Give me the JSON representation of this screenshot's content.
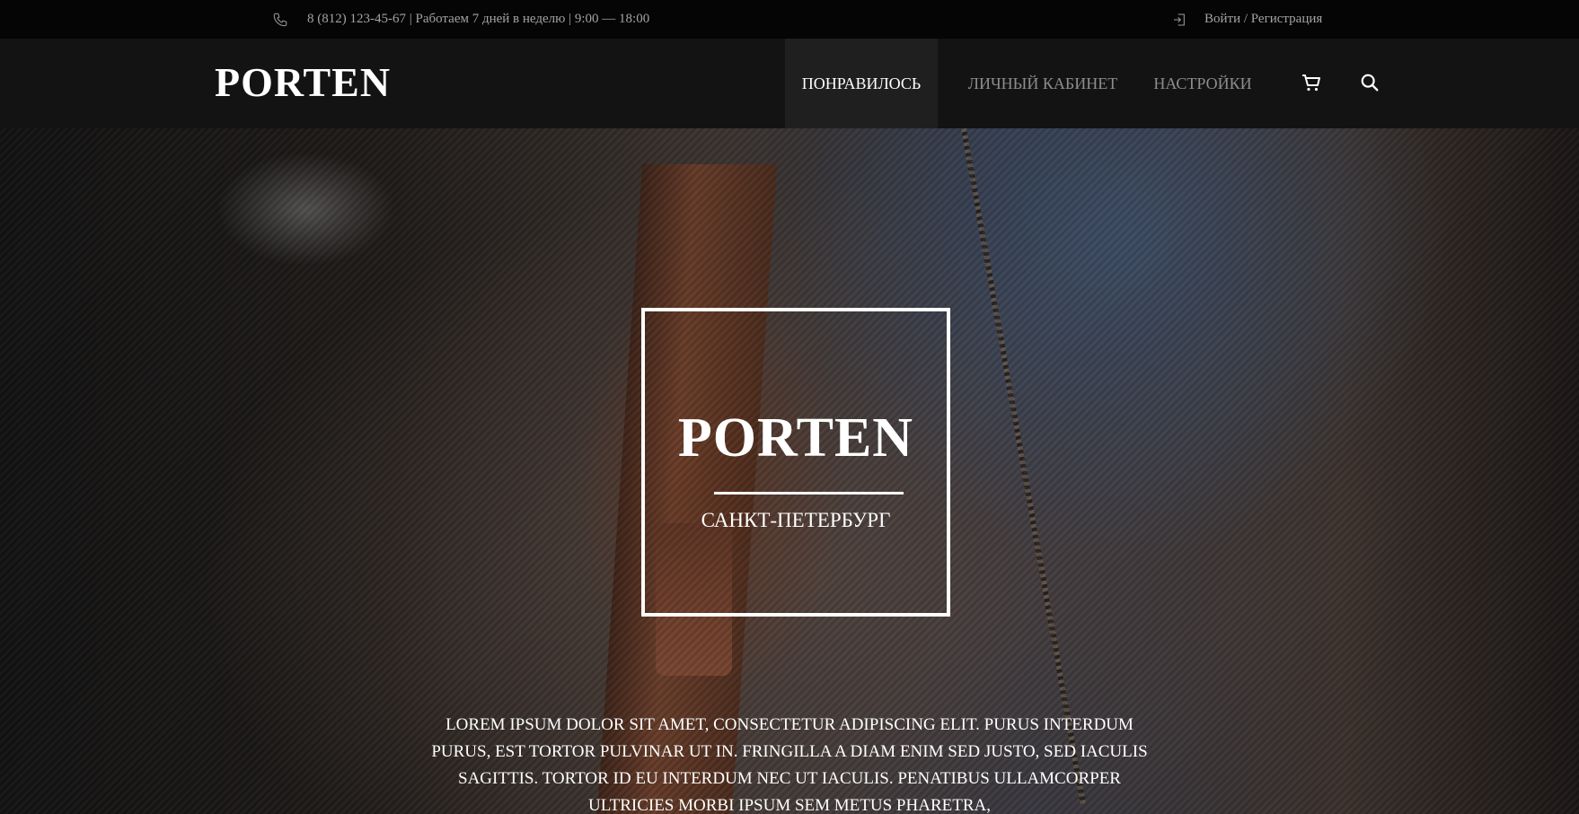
{
  "topbar": {
    "contact": "8 (812) 123-45-67 | Работаем 7 дней в неделю | 9:00 — 18:00",
    "login": "Войти / Регистрация"
  },
  "header": {
    "logo": "PORTEN",
    "nav": [
      {
        "label": "ПОНРАВИЛОСЬ",
        "active": true
      },
      {
        "label": "ЛИЧНЫЙ КАБИНЕТ",
        "active": false
      },
      {
        "label": "НАСТРОЙКИ",
        "active": false
      }
    ],
    "icons": [
      "cart-icon",
      "search-icon"
    ]
  },
  "hero": {
    "title": "PORTEN",
    "city": "САНКТ-ПЕТЕРБУРГ",
    "text": "LOREM IPSUM DOLOR SIT AMET, CONSECTETUR ADIPISCING ELIT. PURUS INTERDUM PURUS, EST TORTOR PULVINAR UT IN. FRINGILLA A DIAM ENIM SED JUSTO, SED IACULIS SAGITTIS. TORTOR ID EU INTERDUM NEC UT IACULIS. PENATIBUS ULLAMCORPER ULTRICIES MORBI IPSUM SEM METUS PHARETRA,"
  },
  "colors": {
    "topbar_bg": "#050505",
    "header_bg": "#131313",
    "nav_active_bg": "#1f1f1f",
    "nav_inactive": "#8d8d8d",
    "text": "#ffffff"
  }
}
